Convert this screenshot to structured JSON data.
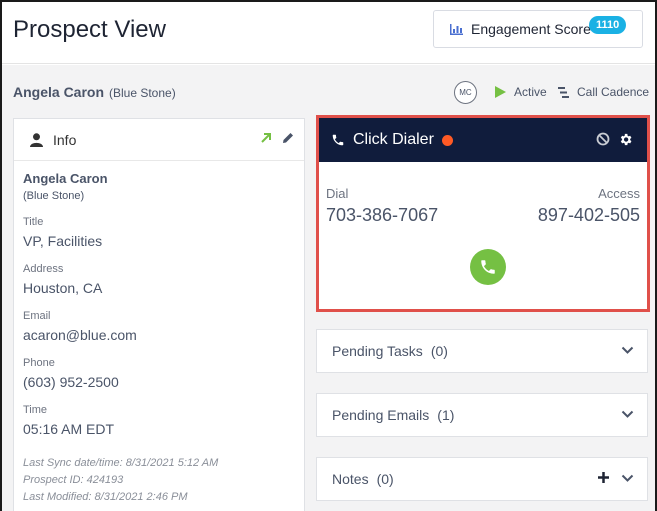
{
  "header": {
    "title": "Prospect View",
    "engagement_label": "Engagement Score",
    "engagement_score": "1110"
  },
  "prospect": {
    "name": "Angela Caron",
    "company": "(Blue Stone)",
    "initials": "MC",
    "status": "Active",
    "cadence": "Call Cadence"
  },
  "info": {
    "title": "Info",
    "name": "Angela Caron",
    "company": "(Blue Stone)",
    "fields": [
      {
        "label": "Title",
        "value": "VP, Facilities"
      },
      {
        "label": "Address",
        "value": "Houston, CA"
      },
      {
        "label": "Email",
        "value": "acaron@blue.com"
      },
      {
        "label": "Phone",
        "value": "(603) 952-2500"
      },
      {
        "label": "Time",
        "value": "05:16 AM EDT"
      }
    ],
    "meta": [
      "Last Sync date/time: 8/31/2021 5:12 AM",
      "Prospect ID: 424193",
      "Last Modified: 8/31/2021 2:46 PM"
    ]
  },
  "dialer": {
    "title": "Click Dialer",
    "dial_label": "Dial",
    "dial_number": "703-386-7067",
    "access_label": "Access",
    "access_number": "897-402-505"
  },
  "sections": [
    {
      "label": "Pending Tasks",
      "count": "(0)"
    },
    {
      "label": "Pending Emails",
      "count": "(1)"
    },
    {
      "label": "Notes",
      "count": "(0)"
    }
  ],
  "colors": {
    "dialer_header": "#101c3c",
    "dialer_border": "#e0504a",
    "call_button": "#75c043",
    "badge": "#1ab1e4",
    "status_dot": "#ff5a25"
  }
}
